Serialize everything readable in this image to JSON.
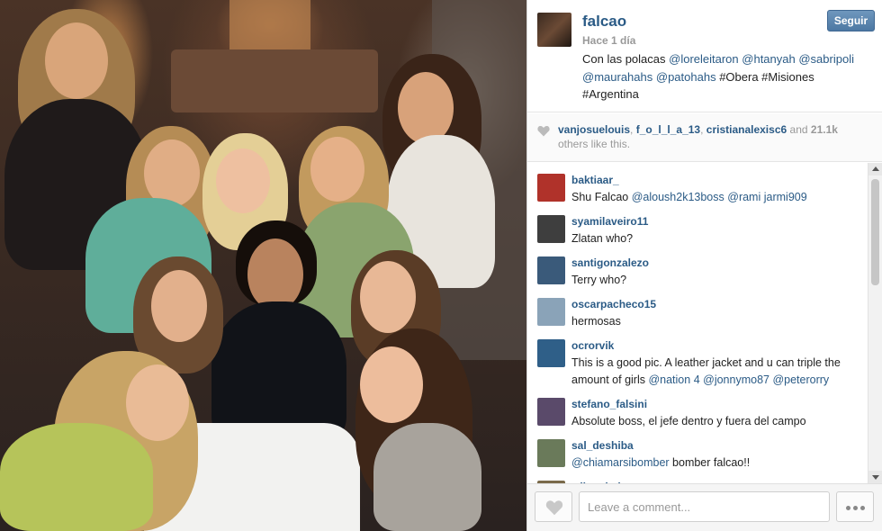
{
  "post": {
    "username": "falcao",
    "follow_label": "Seguir",
    "time": "Hace 1 día",
    "caption": [
      {
        "t": "Con las polacas ",
        "m": false
      },
      {
        "t": "@loreleitaron",
        "m": true
      },
      {
        "t": " ",
        "m": false
      },
      {
        "t": "@htanyah",
        "m": true
      },
      {
        "t": " ",
        "m": false
      },
      {
        "t": "@sabripoli",
        "m": true
      },
      {
        "t": " ",
        "m": false
      },
      {
        "t": "@maurahahs",
        "m": true
      },
      {
        "t": " ",
        "m": false
      },
      {
        "t": "@patohahs",
        "m": true
      },
      {
        "t": " #Obera #Misiones #Argentina",
        "m": false
      }
    ]
  },
  "likes": {
    "users": [
      "vanjosuelouis",
      "f_o_l_l_a_13",
      "cristianalexisc6"
    ],
    "and_text": "and",
    "count": "21.1k",
    "suffix": "others like this."
  },
  "comments": [
    {
      "user": "baktiaar_",
      "avatar_color": "#b0322a",
      "parts": [
        {
          "t": "Shu Falcao ",
          "m": false
        },
        {
          "t": "@aloush2k13boss",
          "m": true
        },
        {
          "t": " ",
          "m": false
        },
        {
          "t": "@rami",
          "m": true
        },
        {
          "t": "  ",
          "m": false
        },
        {
          "t": "jarmi909",
          "m": true
        }
      ]
    },
    {
      "user": "syamilaveiro11",
      "avatar_color": "#3e3e3e",
      "parts": [
        {
          "t": "Zlatan who?",
          "m": false
        }
      ]
    },
    {
      "user": "santigonzalezo",
      "avatar_color": "#3a5a7a",
      "parts": [
        {
          "t": "Terry who?",
          "m": false
        }
      ]
    },
    {
      "user": "oscarpacheco15",
      "avatar_color": "#8aa3b8",
      "parts": [
        {
          "t": "hermosas",
          "m": false
        }
      ]
    },
    {
      "user": "ocrorvik",
      "avatar_color": "#2f5f88",
      "parts": [
        {
          "t": "This is a good pic. A leather jacket and u can triple the amount of girls ",
          "m": false
        },
        {
          "t": "@nation",
          "m": true
        },
        {
          "t": "    ",
          "m": false
        },
        {
          "t": "4 @jonnymo87",
          "m": true
        },
        {
          "t": " ",
          "m": false
        },
        {
          "t": "@peterorry",
          "m": true
        }
      ]
    },
    {
      "user": "stefano_falsini",
      "avatar_color": "#5a4a6a",
      "parts": [
        {
          "t": "Absolute boss, el jefe dentro y fuera del campo",
          "m": false
        }
      ]
    },
    {
      "user": "sal_deshiba",
      "avatar_color": "#6a7a5a",
      "parts": [
        {
          "t": "@chiamarsibomber",
          "m": true
        },
        {
          "t": " bomber falcao!!",
          "m": false
        }
      ]
    },
    {
      "user": "wilsonlatinos",
      "avatar_color": "#7a6a4a",
      "parts": []
    }
  ],
  "comment_box": {
    "placeholder": "Leave a comment..."
  },
  "icons": {
    "like": "heart-icon",
    "more": "ellipsis-icon",
    "likes_heart": "heart-icon"
  },
  "colors": {
    "link": "#2b5b86",
    "follow_button": "#4c78a3"
  }
}
